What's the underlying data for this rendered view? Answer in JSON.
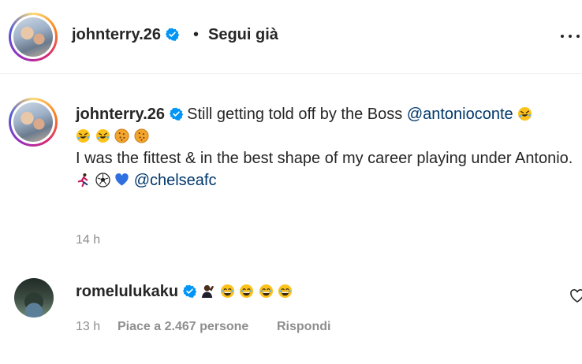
{
  "header": {
    "username": "johnterry.26",
    "dot": "•",
    "follow_status": "Segui già",
    "more_icon": "more-horizontal-icon"
  },
  "caption": {
    "username": "johnterry.26",
    "text_1": "Still getting told off by the Boss",
    "mention_1": "@antonioconte",
    "text_2": "I was the fittest & in the best shape of my career playing under Antonio.",
    "mention_2": "@chelseafc",
    "emojis_line1": [
      "rolling-laughing",
      "rolling-laughing",
      "rolling-laughing",
      "cookie",
      "cookie"
    ],
    "emojis_line3": [
      "runner",
      "soccer-ball",
      "blue-heart"
    ],
    "timestamp": "14 h"
  },
  "comment": {
    "username": "romelulukaku",
    "emojis": [
      "man-gesture",
      "grinning-sweat",
      "grinning-sweat",
      "grinning-sweat",
      "grinning-sweat"
    ],
    "timestamp": "13 h",
    "likes": "Piace a 2.467 persone",
    "reply": "Rispondi"
  },
  "colors": {
    "text": "#262626",
    "muted": "#8e8e8e",
    "mention": "#00376b",
    "verified": "#0095f6"
  }
}
